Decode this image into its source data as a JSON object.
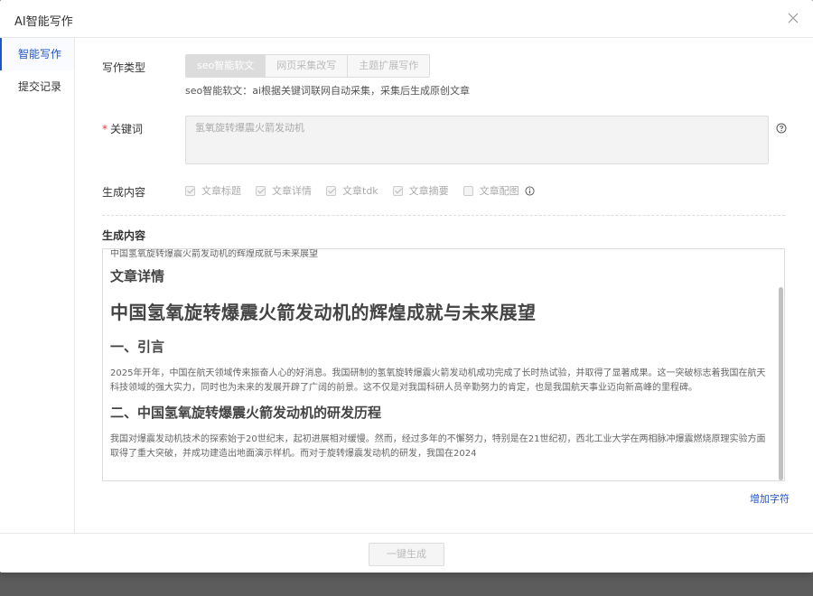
{
  "dialog": {
    "title": "AI智能写作"
  },
  "sidebar": {
    "items": [
      {
        "label": "智能写作"
      },
      {
        "label": "提交记录"
      }
    ]
  },
  "form": {
    "type_label": "写作类型",
    "type_options": [
      {
        "label": "seo智能软文"
      },
      {
        "label": "网页采集改写"
      },
      {
        "label": "主题扩展写作"
      }
    ],
    "type_hint": "seo智能软文：ai根据关键词联网自动采集，采集后生成原创文章",
    "keyword_required_mark": "*",
    "keyword_label": "关键词",
    "keyword_value": "氢氧旋转爆震火箭发动机",
    "gen_label": "生成内容",
    "checks": [
      {
        "label": "文章标题",
        "checked": true
      },
      {
        "label": "文章详情",
        "checked": true
      },
      {
        "label": "文章tdk",
        "checked": true
      },
      {
        "label": "文章摘要",
        "checked": true
      },
      {
        "label": "文章配图",
        "checked": false
      }
    ]
  },
  "content": {
    "title": "生成内容",
    "cut_line": "中国氢氧旋转爆震火箭发动机的辉煌成就与未来展望",
    "detail_heading": "文章详情",
    "main_heading": "中国氢氧旋转爆震火箭发动机的辉煌成就与未来展望",
    "section1_heading": "一、引言",
    "section1_para": "2025年开年，中国在航天领域传来振奋人心的好消息。我国研制的氢氧旋转爆震火箭发动机成功完成了长时热试验，并取得了显著成果。这一突破标志着我国在航天科技领域的强大实力，同时也为未来的发展开辟了广阔的前景。这不仅是对我国科研人员辛勤努力的肯定，也是我国航天事业迈向新高峰的里程碑。",
    "section2_heading": "二、中国氢氧旋转爆震火箭发动机的研发历程",
    "section2_para": "我国对爆震发动机技术的探索始于20世纪末，起初进展相对缓慢。然而，经过多年的不懈努力，特别是在21世纪初，西北工业大学在两相脉冲爆震燃烧原理实验方面取得了重大突破，并成功建造出地面演示样机。而对于旋转爆震发动机的研发，我国在2024"
  },
  "actions": {
    "add_chars": "增加字符",
    "generate": "一键生成"
  },
  "colors": {
    "accent": "#1f55c9",
    "required": "#e4393c"
  }
}
